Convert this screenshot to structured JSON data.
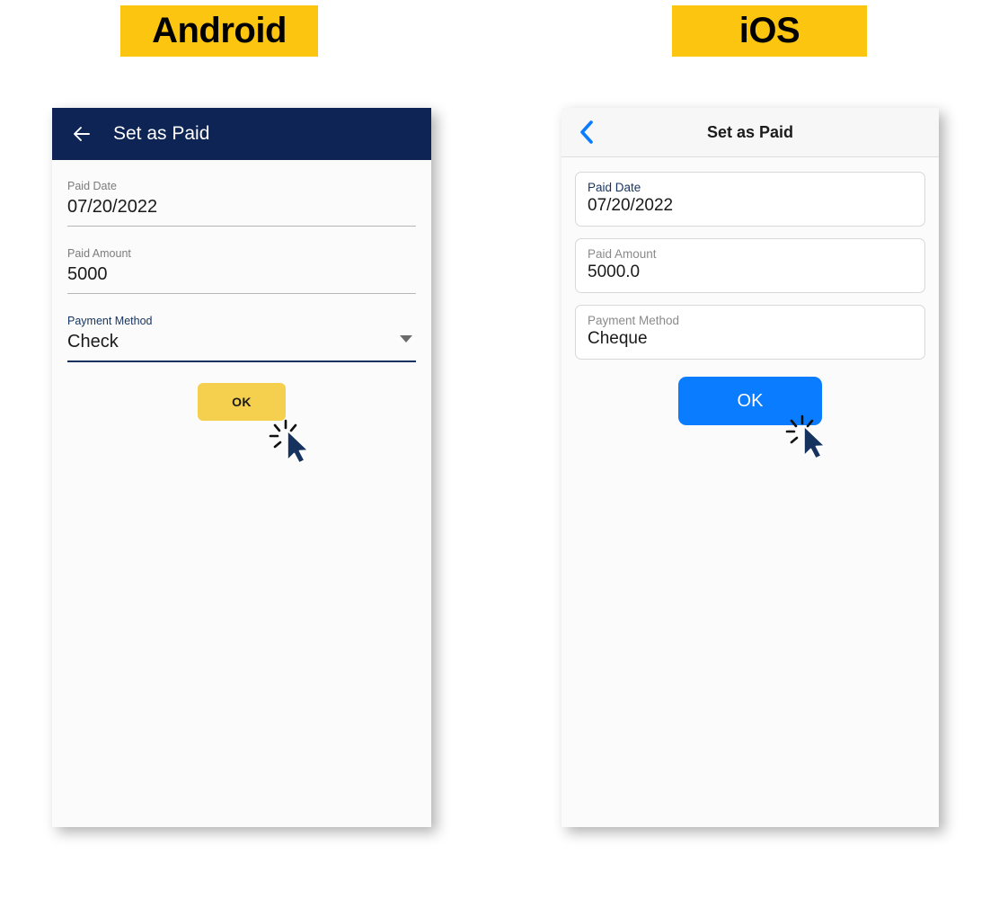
{
  "badges": {
    "android": "Android",
    "ios": "iOS"
  },
  "colors": {
    "badge_bg": "#FCC510",
    "android_appbar": "#0E2454",
    "android_accent": "#16335f",
    "android_ok_bg": "#F5D04E",
    "ios_ok_bg": "#0A7CFF",
    "ios_back_chevron": "#0A7CFF",
    "cursor": "#16335f"
  },
  "android": {
    "appbar": {
      "back_icon": "arrow-left-icon",
      "title": "Set as Paid"
    },
    "fields": [
      {
        "label": "Paid Date",
        "value": "07/20/2022",
        "focused": false,
        "has_caret": false
      },
      {
        "label": "Paid Amount",
        "value": "5000",
        "focused": false,
        "has_caret": false
      },
      {
        "label": "Payment Method",
        "value": "Check",
        "focused": true,
        "has_caret": true
      }
    ],
    "ok_button": "OK"
  },
  "ios": {
    "appbar": {
      "back_icon": "chevron-left-icon",
      "title": "Set as Paid"
    },
    "fields": [
      {
        "label": "Paid Date",
        "value": "07/20/2022",
        "focused": true
      },
      {
        "label": "Paid Amount",
        "value": "5000.0",
        "focused": false
      },
      {
        "label": "Payment Method",
        "value": "Cheque",
        "focused": false
      }
    ],
    "ok_button": "OK"
  }
}
